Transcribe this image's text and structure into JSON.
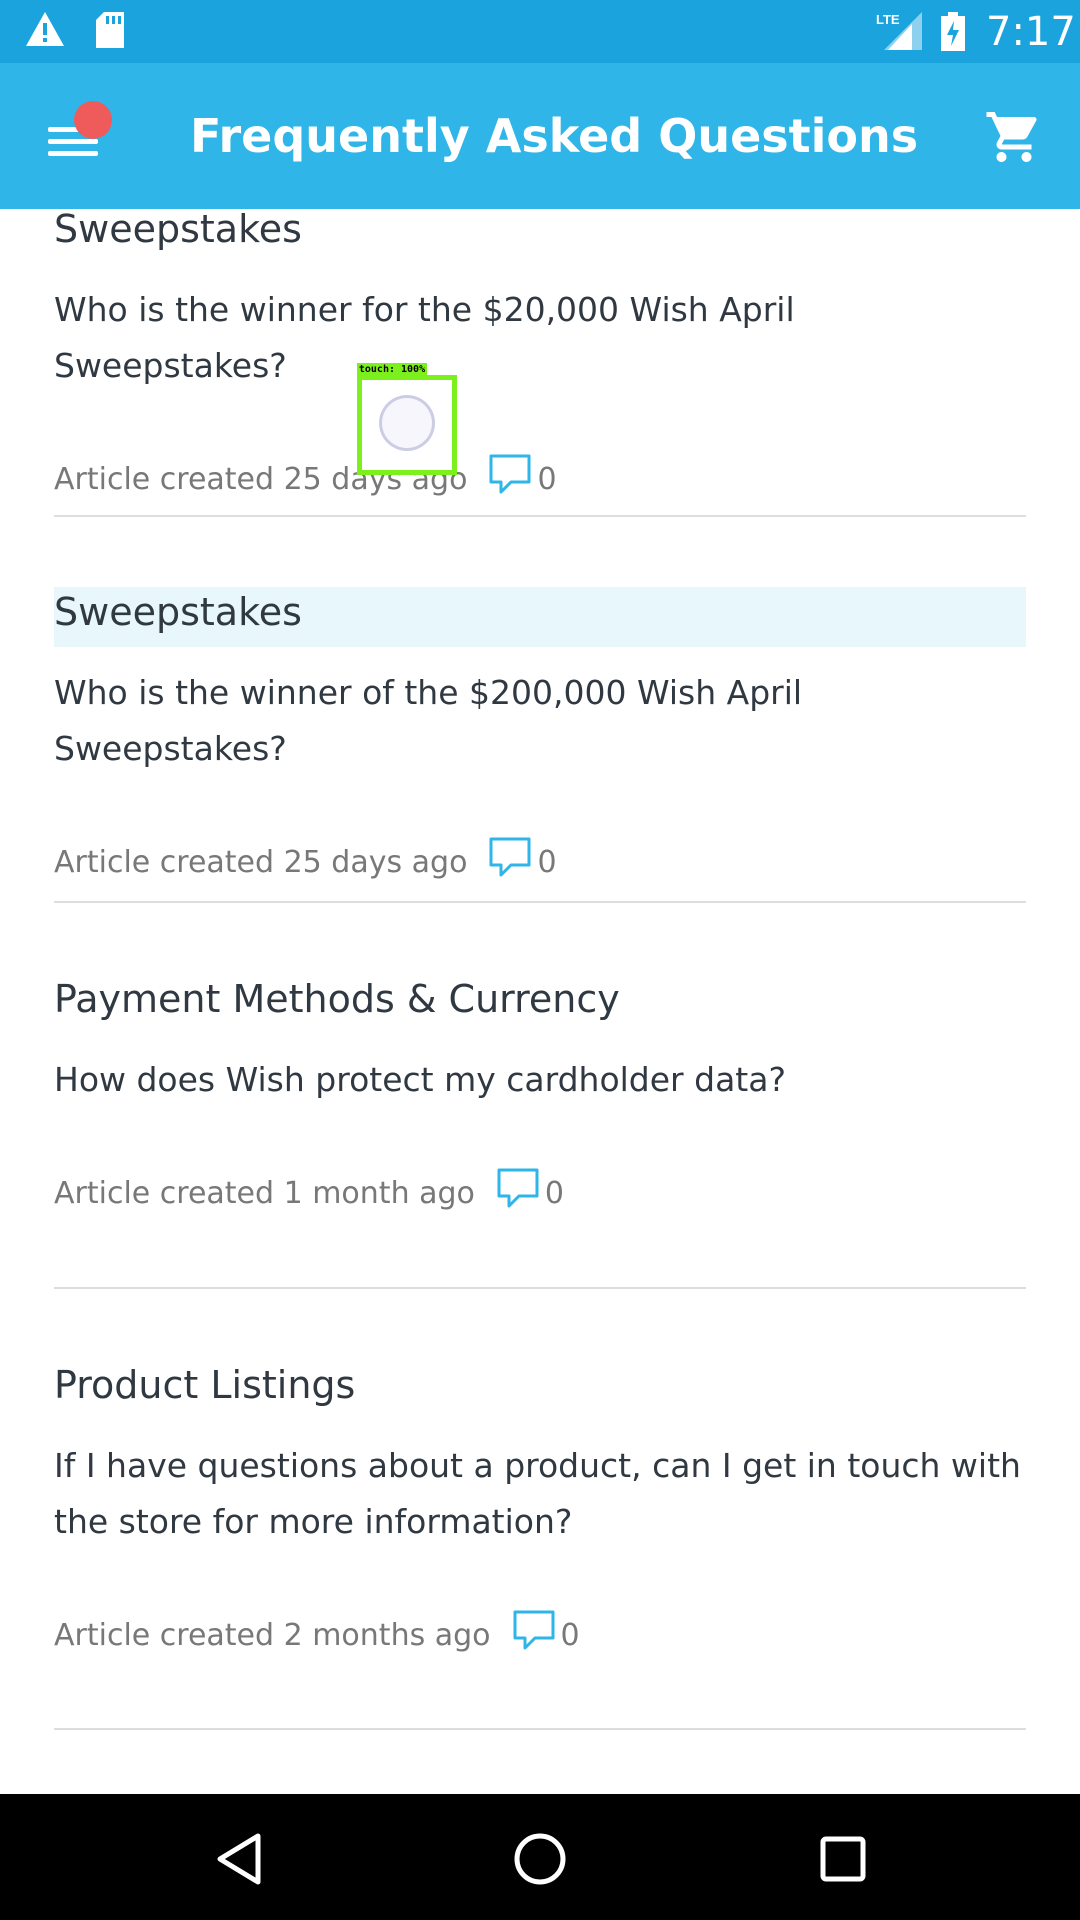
{
  "status_bar": {
    "time": "7:17",
    "network": "LTE",
    "icons": [
      "warning-icon",
      "sd-card-icon",
      "lte-signal-icon",
      "battery-charging-icon"
    ]
  },
  "app_bar": {
    "title": "Frequently Asked Questions",
    "icons": [
      "menu-icon",
      "cart-icon"
    ],
    "notification_dot_color": "#ef5b5b"
  },
  "articles": [
    {
      "category": "Sweepstakes",
      "question": "Who is the winner for the $20,000 Wish April Sweepstakes?",
      "created": "Article created 25 days ago",
      "comments": "0"
    },
    {
      "category": "Sweepstakes",
      "question": "Who is the winner of the $200,000 Wish April Sweepstakes?",
      "created": "Article created 25 days ago",
      "comments": "0"
    },
    {
      "category": "Payment Methods & Currency",
      "question": "How does Wish protect my cardholder data?",
      "created": "Article created 1 month ago",
      "comments": "0"
    },
    {
      "category": "Product Listings",
      "question": "If I have questions about a product, can I get in touch with the store for more information?",
      "created": "Article created 2 months ago",
      "comments": "0"
    }
  ],
  "touch_overlay": {
    "label": "touch: 100%"
  },
  "colors": {
    "status_bar": "#1aa3dd",
    "app_bar": "#2fb5e8",
    "accent": "#2fb5e8",
    "highlight": "#e8f7fc"
  },
  "nav_bar": {
    "icons": [
      "back-icon",
      "home-icon",
      "recents-icon"
    ]
  }
}
